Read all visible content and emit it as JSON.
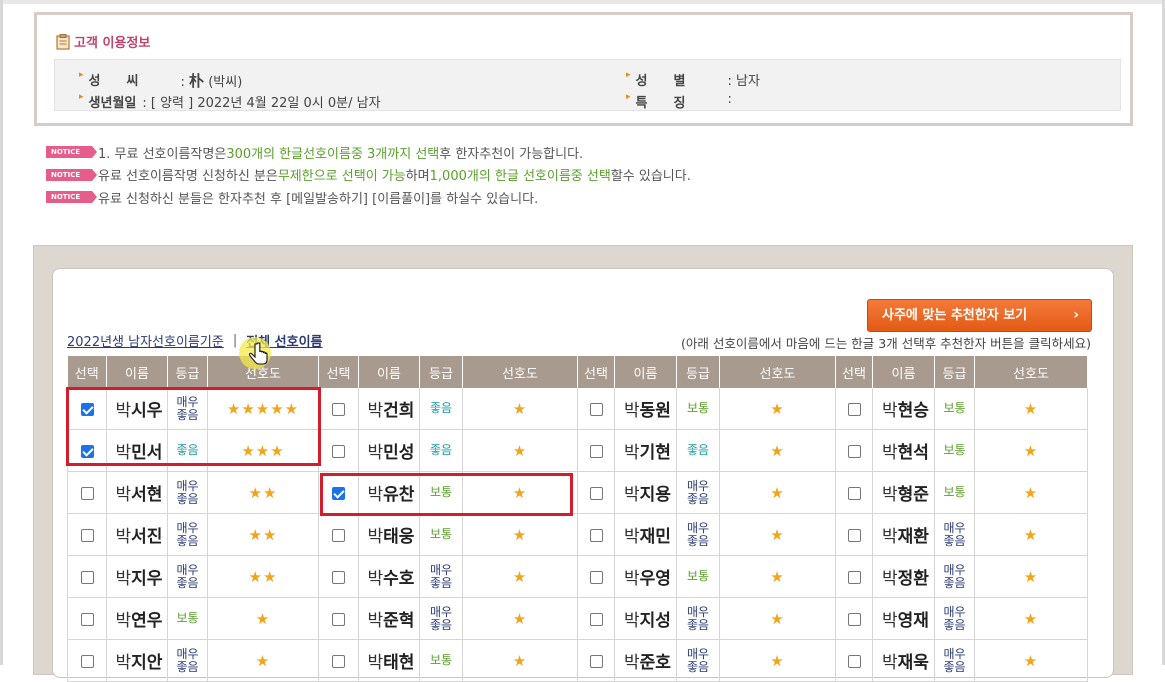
{
  "info": {
    "title": "고객 이용정보",
    "surname_label": "성　　씨",
    "surname_hanja": "朴",
    "surname_reading": "(박씨)",
    "sex_label": "성　　별",
    "sex_value": ": 남자",
    "birth_label": "생년월일",
    "birth_value": ": [ 양력 ] 2022년 4월 22일 0시 0분/ 남자",
    "feature_label": "특　　징",
    "feature_value": ":"
  },
  "notices": {
    "badge": "NOTICE",
    "n1_a": "1. 무료 선호이름작명은 ",
    "n1_hl": "300개의 한글선호이름중 3개까지 선택",
    "n1_b": "후 한자추천이 가능합니다.",
    "n2_a": "유료 선호이름작명 신청하신 분은",
    "n2_hl1": "무제한으로 선택이 가능",
    "n2_b": "하며 ",
    "n2_hl2": "1,000개의 한글 선호이름중 선택",
    "n2_c": "할수 있습니다.",
    "n3": "유료 신청하신 분들은 한자추천 후 [메일발송하기] [이름풀이]를 하실수 있습니다."
  },
  "toolbar": {
    "recommend_button": "사주에 맞는 추천한자 보기",
    "recommend_arrow": "›",
    "tab_male": "2022년생 남자선호이름기준",
    "tab_sep": "|",
    "tab_all": "전체 선호이름",
    "hint": "(아래 선호이름에서 마음에 드는 한글 3개 선택후 추천한자 버튼을 클릭하세요)"
  },
  "headers": {
    "select": "선택",
    "name": "이름",
    "grade": "등급",
    "pref": "선호도"
  },
  "grade_labels": {
    "very1": "매우",
    "very2": "좋음",
    "good": "좋음",
    "norm": "보통"
  },
  "surname": "박",
  "star_char": "★",
  "rows": [
    [
      {
        "given": "시우",
        "grade": "very",
        "stars": 5,
        "checked": true
      },
      {
        "given": "건희",
        "grade": "good",
        "stars": 1,
        "checked": false
      },
      {
        "given": "동원",
        "grade": "norm",
        "stars": 1,
        "checked": false
      },
      {
        "given": "현승",
        "grade": "norm",
        "stars": 1,
        "checked": false
      }
    ],
    [
      {
        "given": "민서",
        "grade": "good",
        "stars": 3,
        "checked": true
      },
      {
        "given": "민성",
        "grade": "good",
        "stars": 1,
        "checked": false
      },
      {
        "given": "기현",
        "grade": "good",
        "stars": 1,
        "checked": false
      },
      {
        "given": "현석",
        "grade": "norm",
        "stars": 1,
        "checked": false
      }
    ],
    [
      {
        "given": "서현",
        "grade": "very",
        "stars": 2,
        "checked": false
      },
      {
        "given": "유찬",
        "grade": "norm",
        "stars": 1,
        "checked": true
      },
      {
        "given": "지용",
        "grade": "very",
        "stars": 1,
        "checked": false
      },
      {
        "given": "형준",
        "grade": "norm",
        "stars": 1,
        "checked": false
      }
    ],
    [
      {
        "given": "서진",
        "grade": "very",
        "stars": 2,
        "checked": false
      },
      {
        "given": "태웅",
        "grade": "norm",
        "stars": 1,
        "checked": false
      },
      {
        "given": "재민",
        "grade": "very",
        "stars": 1,
        "checked": false
      },
      {
        "given": "재환",
        "grade": "very",
        "stars": 1,
        "checked": false
      }
    ],
    [
      {
        "given": "지우",
        "grade": "very",
        "stars": 2,
        "checked": false
      },
      {
        "given": "수호",
        "grade": "very",
        "stars": 1,
        "checked": false
      },
      {
        "given": "우영",
        "grade": "norm",
        "stars": 1,
        "checked": false
      },
      {
        "given": "정환",
        "grade": "very",
        "stars": 1,
        "checked": false
      }
    ],
    [
      {
        "given": "연우",
        "grade": "norm",
        "stars": 1,
        "checked": false
      },
      {
        "given": "준혁",
        "grade": "very",
        "stars": 1,
        "checked": false
      },
      {
        "given": "지성",
        "grade": "very",
        "stars": 1,
        "checked": false
      },
      {
        "given": "영재",
        "grade": "very",
        "stars": 1,
        "checked": false
      }
    ],
    [
      {
        "given": "지안",
        "grade": "very",
        "stars": 1,
        "checked": false
      },
      {
        "given": "태현",
        "grade": "norm",
        "stars": 1,
        "checked": false
      },
      {
        "given": "준호",
        "grade": "very",
        "stars": 1,
        "checked": false
      },
      {
        "given": "재욱",
        "grade": "very",
        "stars": 1,
        "checked": false
      }
    ]
  ],
  "colors": {
    "accent_orange": "#e25a14",
    "notice_pink": "#e65c8a",
    "header_bg": "#a89a8e",
    "highlight_red": "#d21e2c",
    "star": "#f2a519"
  }
}
